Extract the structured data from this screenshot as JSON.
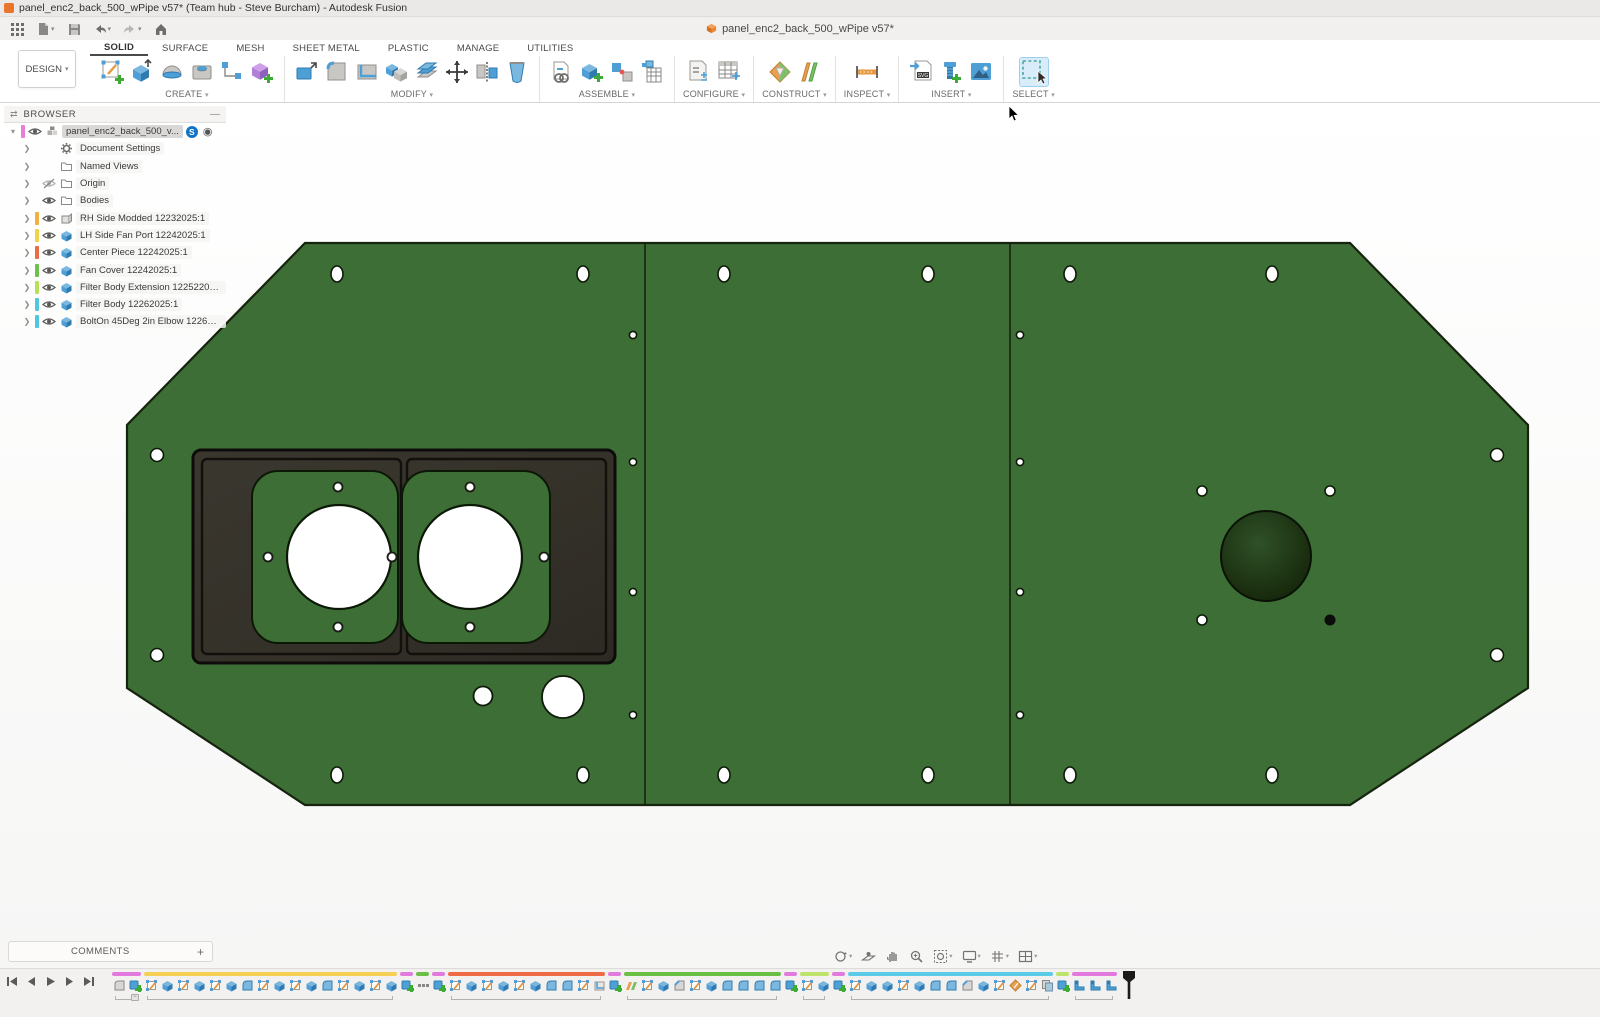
{
  "window": {
    "title": "panel_enc2_back_500_wPipe v57* (Team hub - Steve Burcham) - Autodesk Fusion",
    "app_badge_color": "#e8762c"
  },
  "qat": {
    "items": [
      {
        "name": "app-grid",
        "caret": false
      },
      {
        "name": "file",
        "caret": true
      },
      {
        "name": "save",
        "caret": false
      },
      {
        "name": "undo",
        "caret": true
      },
      {
        "name": "redo",
        "caret": true
      },
      {
        "name": "home",
        "caret": false
      }
    ]
  },
  "document_tab": {
    "label": "panel_enc2_back_500_wPipe v57*",
    "icon_color": "#e8882f"
  },
  "ribbon": {
    "workspace": "DESIGN",
    "tabs": [
      {
        "label": "SOLID",
        "active": true
      },
      {
        "label": "SURFACE",
        "active": false
      },
      {
        "label": "MESH",
        "active": false
      },
      {
        "label": "SHEET METAL",
        "active": false
      },
      {
        "label": "PLASTIC",
        "active": false
      },
      {
        "label": "MANAGE",
        "active": false
      },
      {
        "label": "UTILITIES",
        "active": false
      }
    ],
    "groups": [
      {
        "label": "CREATE",
        "tools": [
          "create-sketch",
          "extrude",
          "revolve",
          "hole",
          "pattern",
          "create-form"
        ]
      },
      {
        "label": "MODIFY",
        "tools": [
          "press-pull",
          "fillet",
          "shell",
          "combine",
          "offset-face",
          "move",
          "align",
          "delete"
        ]
      },
      {
        "label": "ASSEMBLE",
        "tools": [
          "insert-derive",
          "new-component",
          "joint",
          "motion-study"
        ]
      },
      {
        "label": "CONFIGURE",
        "tools": [
          "configuration",
          "config-table"
        ]
      },
      {
        "label": "CONSTRUCT",
        "tools": [
          "midplane",
          "offset-plane"
        ]
      },
      {
        "label": "INSPECT",
        "tools": [
          "measure"
        ]
      },
      {
        "label": "INSERT",
        "tools": [
          "insert-svg",
          "insert-fastener",
          "canvas"
        ]
      },
      {
        "label": "SELECT",
        "tools": [
          "select"
        ]
      }
    ],
    "active_tool": "select"
  },
  "browser": {
    "title": "BROWSER",
    "root": {
      "label": "panel_enc2_back_500_v...",
      "chip": "#e87fd6",
      "badge": "S"
    },
    "items": [
      {
        "icon": "gear",
        "label": "Document Settings",
        "chip": null,
        "eye": null
      },
      {
        "icon": "folder",
        "label": "Named Views",
        "chip": null,
        "eye": null
      },
      {
        "icon": "folder",
        "label": "Origin",
        "chip": null,
        "eye": "off"
      },
      {
        "icon": "folder",
        "label": "Bodies",
        "chip": null,
        "eye": "on"
      },
      {
        "icon": "sheet",
        "label": "RH Side Modded 12232025:1",
        "chip": "#f2b03f",
        "eye": "on"
      },
      {
        "icon": "cube",
        "label": "LH Side Fan Port 12242025:1",
        "chip": "#f0d348",
        "eye": "on"
      },
      {
        "icon": "cube",
        "label": "Center Piece 12242025:1",
        "chip": "#ec6a45",
        "eye": "on"
      },
      {
        "icon": "cube",
        "label": "Fan Cover 12242025:1",
        "chip": "#6cc24a",
        "eye": "on"
      },
      {
        "icon": "cube",
        "label": "Filter Body Extension 122522025:...",
        "chip": "#b5e05a",
        "eye": "on"
      },
      {
        "icon": "cube",
        "label": "Filter Body 12262025:1",
        "chip": "#4fc7e0",
        "eye": "on"
      },
      {
        "icon": "cube",
        "label": "BoltOn 45Deg 2in Elbow 1226202...",
        "chip": "#4fc7e0",
        "eye": "on"
      }
    ]
  },
  "canvas": {
    "model": {
      "panel_color": "#3d6e35",
      "outline_color": "#16230e",
      "cover_color": "#343129",
      "cover_line_color": "#12100c",
      "dome_center_color": "#2f5128",
      "dome_edge_color": "#142408",
      "hole_color": "#ffffff"
    }
  },
  "comments": {
    "label": "COMMENTS",
    "add_label": "+"
  },
  "navbar": {
    "items": [
      {
        "name": "orbit",
        "caret": true
      },
      {
        "name": "look-at",
        "caret": false
      },
      {
        "name": "pan",
        "caret": false
      },
      {
        "name": "zoom",
        "caret": false
      },
      {
        "name": "fit",
        "caret": true
      },
      {
        "name": "display-settings",
        "caret": true
      },
      {
        "name": "grid-and-snaps",
        "caret": true
      },
      {
        "name": "viewports",
        "caret": true
      }
    ]
  },
  "timeline": {
    "playback": [
      "go-to-start",
      "step-back",
      "play",
      "step-forward",
      "go-to-end"
    ],
    "group_colors": {
      "m": "#e279dd",
      "y": "#f6cf55",
      "o": "#ee6b45",
      "g": "#6abf45",
      "lg": "#bde36a",
      "c": "#5bcbe8"
    },
    "features": [
      {
        "t": "base",
        "g": "m"
      },
      {
        "t": "component",
        "g": "m"
      },
      {
        "t": "sketch",
        "g": "y"
      },
      {
        "t": "extrude",
        "g": "y"
      },
      {
        "t": "sketch",
        "g": "y"
      },
      {
        "t": "extrude",
        "g": "y"
      },
      {
        "t": "sketch",
        "g": "y"
      },
      {
        "t": "extrude",
        "g": "y"
      },
      {
        "t": "fillet",
        "g": "y"
      },
      {
        "t": "sketch",
        "g": "y"
      },
      {
        "t": "extrude",
        "g": "y"
      },
      {
        "t": "sketch",
        "g": "y"
      },
      {
        "t": "extrude",
        "g": "y"
      },
      {
        "t": "fillet",
        "g": "y"
      },
      {
        "t": "sketch",
        "g": "y"
      },
      {
        "t": "extrude",
        "g": "y"
      },
      {
        "t": "sketch",
        "g": "y"
      },
      {
        "t": "extrude",
        "g": "y"
      },
      {
        "t": "component",
        "g": "m"
      },
      {
        "t": "pattern",
        "g": "g"
      },
      {
        "t": "component",
        "g": "m"
      },
      {
        "t": "sketch",
        "g": "o"
      },
      {
        "t": "extrude",
        "g": "o"
      },
      {
        "t": "sketch",
        "g": "o"
      },
      {
        "t": "extrude",
        "g": "o"
      },
      {
        "t": "sketch",
        "g": "o"
      },
      {
        "t": "extrude",
        "g": "o"
      },
      {
        "t": "fillet",
        "g": "o"
      },
      {
        "t": "fillet",
        "g": "o"
      },
      {
        "t": "sketch",
        "g": "o"
      },
      {
        "t": "shell",
        "g": "o"
      },
      {
        "t": "component",
        "g": "m"
      },
      {
        "t": "plane",
        "g": "g"
      },
      {
        "t": "sketch",
        "g": "g"
      },
      {
        "t": "extrude",
        "g": "g"
      },
      {
        "t": "chamfer",
        "g": "g"
      },
      {
        "t": "sketch",
        "g": "g"
      },
      {
        "t": "extrude",
        "g": "g"
      },
      {
        "t": "fillet",
        "g": "g"
      },
      {
        "t": "fillet",
        "g": "g"
      },
      {
        "t": "fillet",
        "g": "g"
      },
      {
        "t": "fillet",
        "g": "g"
      },
      {
        "t": "component",
        "g": "m"
      },
      {
        "t": "sketch",
        "g": "lg"
      },
      {
        "t": "extrude",
        "g": "lg"
      },
      {
        "t": "component",
        "g": "m"
      },
      {
        "t": "sketch",
        "g": "c"
      },
      {
        "t": "extrude",
        "g": "c"
      },
      {
        "t": "extrude",
        "g": "c"
      },
      {
        "t": "sketch",
        "g": "c"
      },
      {
        "t": "extrude",
        "g": "c"
      },
      {
        "t": "fillet",
        "g": "c"
      },
      {
        "t": "fillet",
        "g": "c"
      },
      {
        "t": "chamfer",
        "g": "c"
      },
      {
        "t": "extrude",
        "g": "c"
      },
      {
        "t": "sketch",
        "g": "c"
      },
      {
        "t": "axis",
        "g": "c"
      },
      {
        "t": "sketch",
        "g": "c"
      },
      {
        "t": "copy",
        "g": "c"
      },
      {
        "t": "component",
        "g": "lg"
      },
      {
        "t": "joint",
        "g": "m"
      },
      {
        "t": "joint",
        "g": "m"
      },
      {
        "t": "joint",
        "g": "m"
      }
    ]
  }
}
